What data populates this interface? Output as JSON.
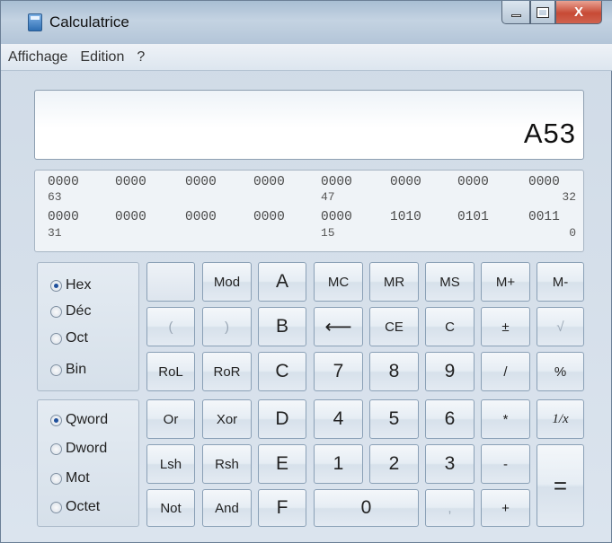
{
  "window": {
    "title": "Calculatrice",
    "close_label": "X"
  },
  "menu": {
    "items": [
      "Affichage",
      "Edition",
      "?"
    ]
  },
  "display": {
    "value": "A53"
  },
  "bits": {
    "row1": [
      "0000",
      "0000",
      "0000",
      "0000",
      "0000",
      "0000",
      "0000",
      "0000"
    ],
    "row1_labels": {
      "left": "63",
      "mid": "47",
      "right": "32"
    },
    "row2": [
      "0000",
      "0000",
      "0000",
      "0000",
      "0000",
      "1010",
      "0101",
      "0011"
    ],
    "row2_labels": {
      "left": "31",
      "mid": "15",
      "right": "0"
    }
  },
  "base_group": {
    "options": [
      {
        "label": "Hex",
        "selected": true
      },
      {
        "label": "Déc",
        "selected": false
      },
      {
        "label": "Oct",
        "selected": false
      },
      {
        "label": "Bin",
        "selected": false
      }
    ]
  },
  "word_group": {
    "options": [
      {
        "label": "Qword",
        "selected": true
      },
      {
        "label": "Dword",
        "selected": false
      },
      {
        "label": "Mot",
        "selected": false
      },
      {
        "label": "Octet",
        "selected": false
      }
    ]
  },
  "keys": {
    "blank": "",
    "mod": "Mod",
    "a": "A",
    "mc": "MC",
    "mr": "MR",
    "ms": "MS",
    "mplus": "M+",
    "mminus": "M-",
    "lparen": "(",
    "rparen": ")",
    "b": "B",
    "backspace": "⟵",
    "ce": "CE",
    "c": "C",
    "plusminus": "±",
    "sqrt": "√",
    "rol": "RoL",
    "ror": "RoR",
    "c_hex": "C",
    "seven": "7",
    "eight": "8",
    "nine": "9",
    "divide": "/",
    "percent": "%",
    "or": "Or",
    "xor": "Xor",
    "d": "D",
    "four": "4",
    "five": "5",
    "six": "6",
    "multiply": "*",
    "reciprocal": "1/x",
    "lsh": "Lsh",
    "rsh": "Rsh",
    "e": "E",
    "one": "1",
    "two": "2",
    "three": "3",
    "minus": "-",
    "equals": "=",
    "not": "Not",
    "and": "And",
    "f": "F",
    "zero": "0",
    "comma": ",",
    "plus": "+"
  }
}
